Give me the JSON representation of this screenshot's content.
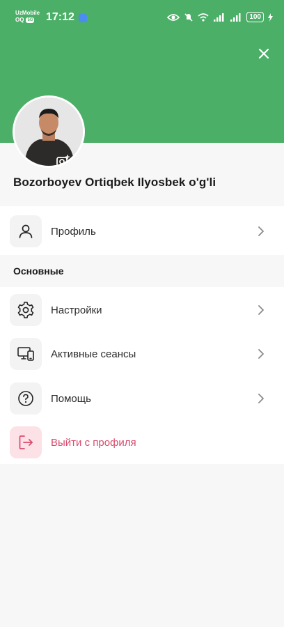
{
  "status_bar": {
    "carrier_line1": "UzMobile",
    "carrier_line2": "OQ",
    "network_badge": "5G",
    "time": "17:12",
    "battery": "100"
  },
  "header": {
    "accent_color": "#4caf68"
  },
  "user": {
    "name": "Bozorboyev Ortiqbek Ilyosbek o'g'li"
  },
  "profile_item": {
    "label": "Профиль",
    "icon": "user-icon"
  },
  "main_section": {
    "title": "Основные",
    "items": [
      {
        "label": "Настройки",
        "icon": "settings-icon"
      },
      {
        "label": "Активные сеансы",
        "icon": "devices-icon"
      },
      {
        "label": "Помощь",
        "icon": "help-icon"
      },
      {
        "label": "Выйти с профиля",
        "icon": "logout-icon",
        "danger_color": "#d94a6b"
      }
    ]
  }
}
